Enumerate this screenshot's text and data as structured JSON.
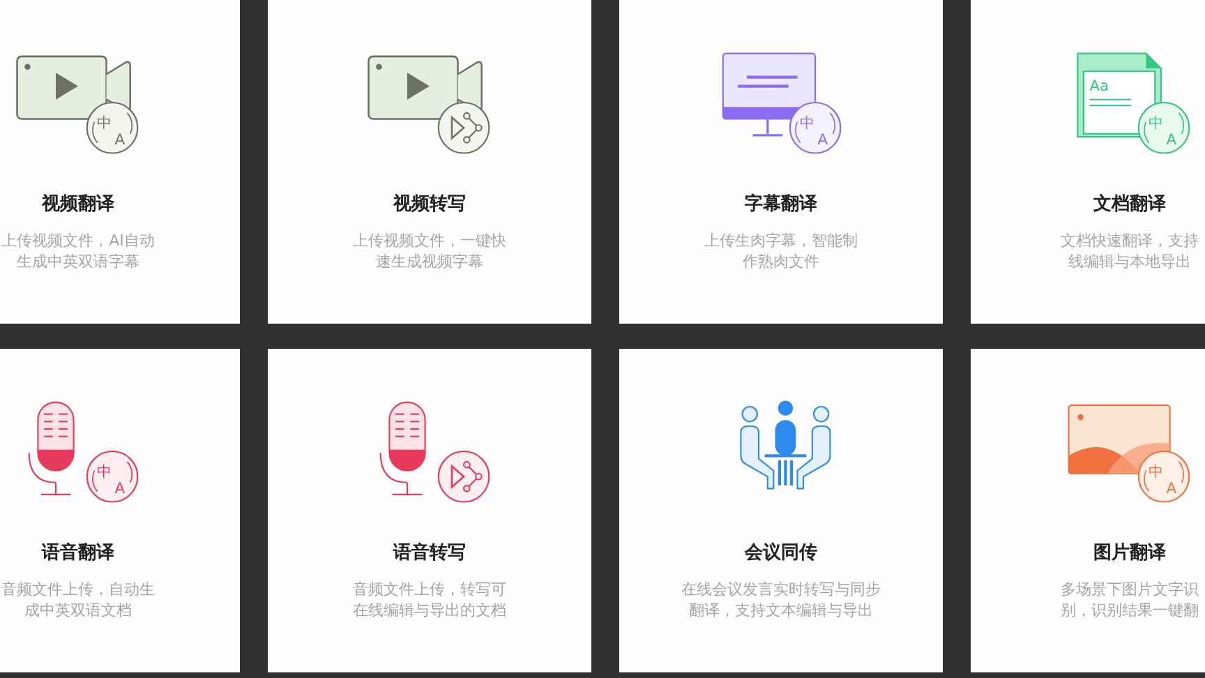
{
  "cards": [
    {
      "title": "视频翻译",
      "description": [
        "上传视频文件，AI自动",
        "生成中英双语字幕"
      ],
      "icon": {
        "kind": "video"
      },
      "badge": {
        "kind": "translate",
        "texts": [
          "中",
          "A"
        ]
      }
    },
    {
      "title": "视频转写",
      "description": [
        "上传视频文件，一键快",
        "速生成视频字幕"
      ],
      "icon": {
        "kind": "video"
      },
      "badge": {
        "kind": "transcribe"
      }
    },
    {
      "title": "字幕翻译",
      "description": [
        "上传生肉字幕，智能制",
        "作熟肉文件"
      ],
      "icon": {
        "kind": "monitor"
      },
      "badge": {
        "kind": "translate",
        "texts": [
          "中",
          "A"
        ]
      }
    },
    {
      "title": "文档翻译",
      "description": [
        "文档快速翻译，支持",
        "线编辑与本地导出"
      ],
      "icon": {
        "kind": "document",
        "texts": [
          "Aa"
        ]
      },
      "badge": {
        "kind": "translate",
        "texts": [
          "中",
          "A"
        ]
      }
    },
    {
      "title": "语音翻译",
      "description": [
        "音频文件上传，自动生",
        "成中英双语文档"
      ],
      "icon": {
        "kind": "microphone"
      },
      "badge": {
        "kind": "translate",
        "texts": [
          "中",
          "A"
        ]
      }
    },
    {
      "title": "语音转写",
      "description": [
        "音频文件上传，转写可",
        "在线编辑与导出的文档"
      ],
      "icon": {
        "kind": "microphone"
      },
      "badge": {
        "kind": "transcribe"
      }
    },
    {
      "title": "会议同传",
      "description": [
        "在线会议发言实时转写与同步",
        "翻译，支持文本编辑与导出"
      ],
      "icon": {
        "kind": "meeting"
      }
    },
    {
      "title": "图片翻译",
      "description": [
        "多场景下图片文字识",
        "别，识别结果一键翻"
      ],
      "icon": {
        "kind": "image"
      },
      "badge": {
        "kind": "translate",
        "texts": [
          "中",
          "A"
        ]
      }
    }
  ]
}
